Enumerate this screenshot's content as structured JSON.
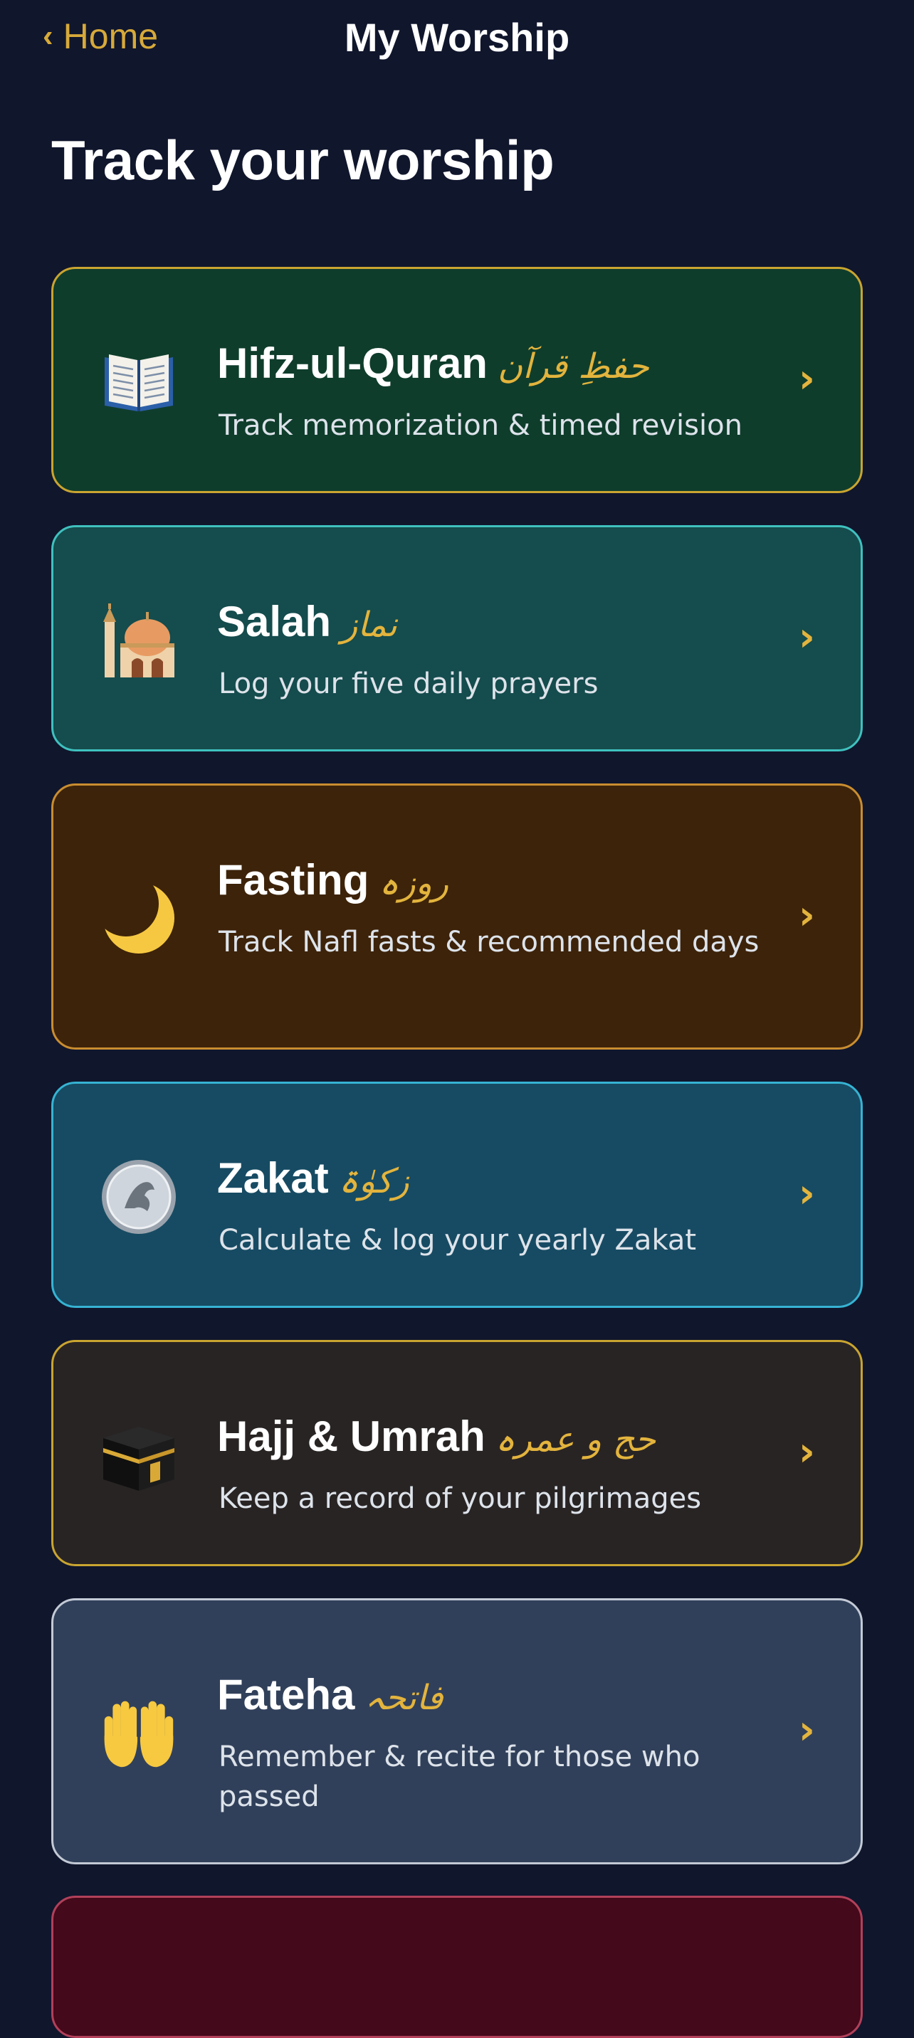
{
  "nav": {
    "back_label": "Home",
    "title": "My Worship"
  },
  "page": {
    "heading": "Track your worship"
  },
  "cards": [
    {
      "title": "Hifz-ul-Quran",
      "urdu": "حفظِ قرآن",
      "description": "Track memorization & timed revision",
      "icon": "book-icon",
      "bg": "#0f3d2c",
      "border": "#c9a530"
    },
    {
      "title": "Salah",
      "urdu": "نماز",
      "description": "Log your five daily prayers",
      "icon": "mosque-icon",
      "bg": "#154c4d",
      "border": "#3fc1bf"
    },
    {
      "title": "Fasting",
      "urdu": "روزہ",
      "description": "Track Nafl fasts & recommended days",
      "icon": "crescent-moon-icon",
      "bg": "#3d230a",
      "border": "#c98d30"
    },
    {
      "title": "Zakat",
      "urdu": "زکوٰۃ",
      "description": "Calculate & log your yearly Zakat",
      "icon": "coin-icon",
      "bg": "#174b63",
      "border": "#36b3d3"
    },
    {
      "title": "Hajj & Umrah",
      "urdu": "حج و عمرہ",
      "description": "Keep a record of your pilgrimages",
      "icon": "kaaba-icon",
      "bg": "#292424",
      "border": "#c9a530"
    },
    {
      "title": "Fateha",
      "urdu": "فاتحہ",
      "description": "Remember & recite for those who passed",
      "icon": "raised-hands-icon",
      "bg": "#31405a",
      "border": "#c3cad6"
    }
  ],
  "partial_card": {
    "bg": "#44091a",
    "border": "#b2405a"
  },
  "colors": {
    "background": "#10162c",
    "accent": "#d6a93a"
  }
}
